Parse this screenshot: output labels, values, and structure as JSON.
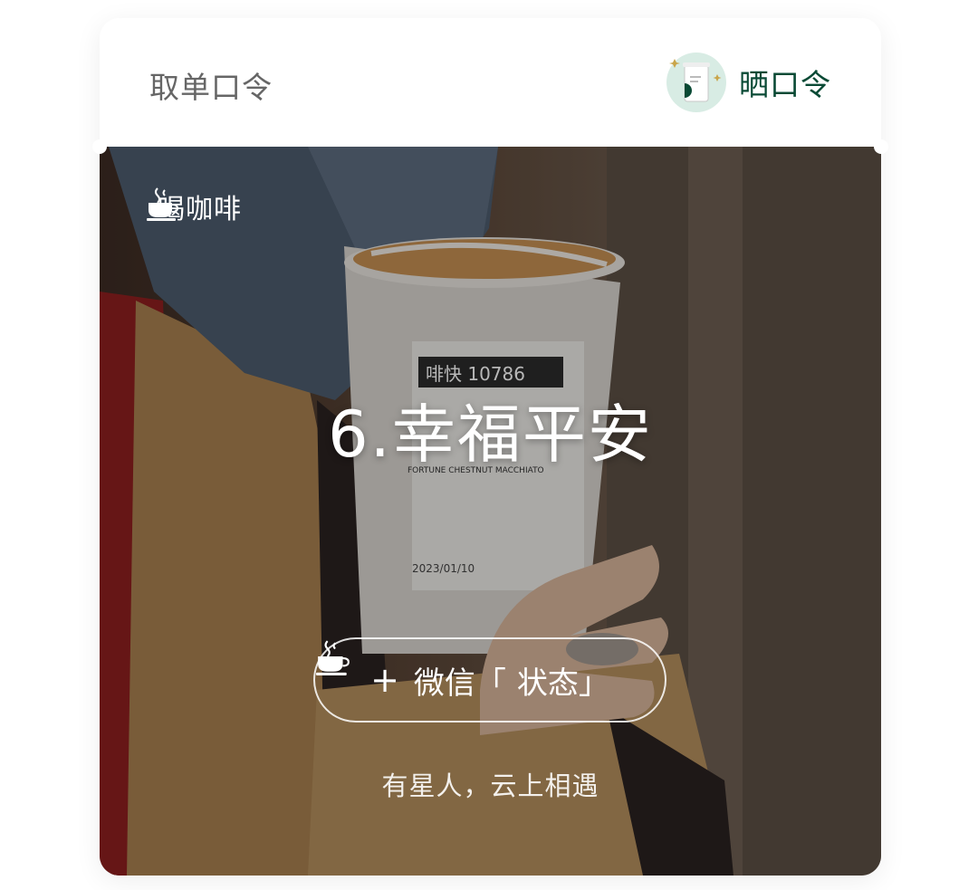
{
  "header": {
    "title": "取单口令",
    "share_label": "晒口令",
    "share_icon": "cup-avatar-icon"
  },
  "hero": {
    "tag_icon": "coffee-cup-icon",
    "tag_label": "喝咖啡",
    "phrase": "6.幸福平安",
    "cup_label": {
      "order_no": "啡快 10786",
      "product_en": "FORTUNE CHESTNUT MACCHIATO",
      "date": "2023/01/10"
    }
  },
  "actions": {
    "status_plus": "+",
    "status_prefix": "微信「",
    "status_suffix": "状态」",
    "status_icon": "coffee-cup-icon"
  },
  "footer": {
    "slogan": "有星人，云上相遇"
  },
  "colors": {
    "accent": "#0a4a35",
    "title_gray": "#666666"
  }
}
